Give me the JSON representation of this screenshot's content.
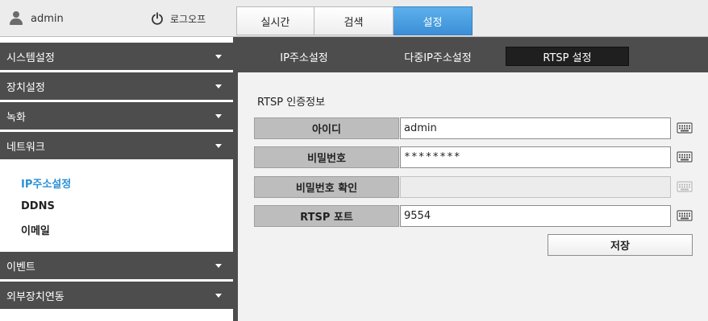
{
  "header": {
    "username": "admin",
    "logout_label": "로그오프",
    "tabs": [
      {
        "label": "실시간",
        "active": false
      },
      {
        "label": "검색",
        "active": false
      },
      {
        "label": "설정",
        "active": true
      }
    ]
  },
  "sidebar": {
    "groups": [
      {
        "label": "시스템설정"
      },
      {
        "label": "장치설정"
      },
      {
        "label": "녹화"
      },
      {
        "label": "네트워크",
        "expanded": true,
        "items": [
          {
            "label": "IP주소설정",
            "active": true
          },
          {
            "label": "DDNS",
            "active": false
          },
          {
            "label": "이메일",
            "active": false
          }
        ]
      },
      {
        "label": "이벤트"
      },
      {
        "label": "외부장치연동"
      }
    ]
  },
  "subtabs": [
    {
      "label": "IP주소설정",
      "active": false
    },
    {
      "label": "다중IP주소설정",
      "active": false
    },
    {
      "label": "RTSP 설정",
      "active": true
    }
  ],
  "form": {
    "section_title": "RTSP 인증정보",
    "fields": [
      {
        "label": "아이디",
        "value": "admin",
        "disabled": false
      },
      {
        "label": "비밀번호",
        "value": "********",
        "disabled": false
      },
      {
        "label": "비밀번호 확인",
        "value": "",
        "disabled": true
      },
      {
        "label": "RTSP 포트",
        "value": "9554",
        "disabled": false
      }
    ],
    "save_label": "저장"
  },
  "colors": {
    "accent": "#3c8fd5",
    "active_menu_text": "#2b8fd4",
    "menu_bar": "#4d4d4d",
    "content_bg": "#f2f2f2"
  },
  "icons": {
    "user": "user-icon",
    "logout": "power-icon",
    "menu_caret": "chevron-down-icon",
    "keyboard": "keyboard-icon"
  }
}
